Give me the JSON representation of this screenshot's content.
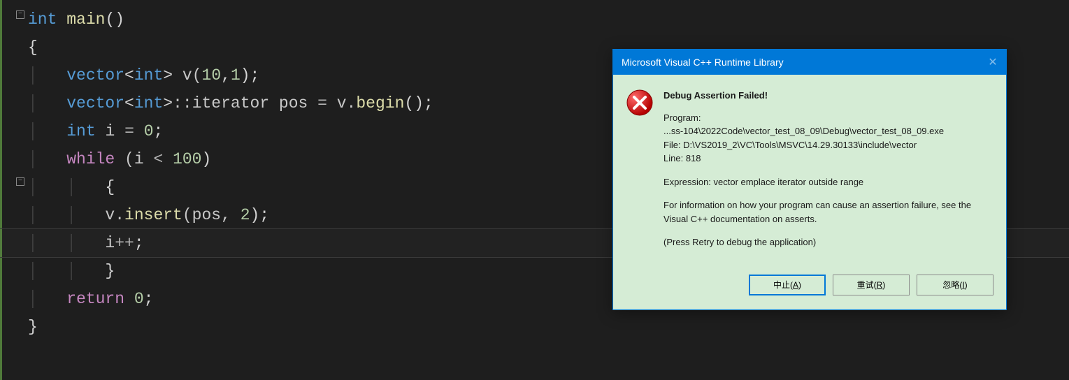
{
  "code": {
    "l1_int": "int",
    "l1_main": "main",
    "l1_parens": "()",
    "l2": "{",
    "l3_vector": "vector",
    "l3_int": "int",
    "l3_v": " v(",
    "l3_10": "10",
    "l3_comma": ",",
    "l3_1": "1",
    "l3_close": ");",
    "l4_vector": "vector",
    "l4_int": "int",
    "l4_iter": "::iterator pos ",
    "l4_eq": "=",
    "l4_vbegin": " v.",
    "l4_begin": "begin",
    "l4_end": "();",
    "l5_int": "int",
    "l5_rest": " i ",
    "l5_eq": "=",
    "l5_sp": " ",
    "l5_0": "0",
    "l5_semi": ";",
    "l6_while": "while",
    "l6_open": " (i ",
    "l6_lt": "<",
    "l6_sp": " ",
    "l6_100": "100",
    "l6_close": ")",
    "l7": "{",
    "l8_vinsert": "v.",
    "l8_insert": "insert",
    "l8_args": "(pos, ",
    "l8_2": "2",
    "l8_close": ");",
    "l9": "i",
    "l9_pp": "++",
    "l9_semi": ";",
    "l10": "}",
    "l11_return": "return",
    "l11_sp": " ",
    "l11_0": "0",
    "l11_semi": ";",
    "l12": "}"
  },
  "dialog": {
    "title": "Microsoft Visual C++ Runtime Library",
    "heading": "Debug Assertion Failed!",
    "program_label": "Program:",
    "program_path": "...ss-104\\2022Code\\vector_test_08_09\\Debug\\vector_test_08_09.exe",
    "file_label": "File: ",
    "file_path": "D:\\VS2019_2\\VC\\Tools\\MSVC\\14.29.30133\\include\\vector",
    "line_label": "Line: ",
    "line_num": "818",
    "expr_label": "Expression: ",
    "expr_text": "vector emplace iterator outside range",
    "info_text": "For information on how your program can cause an assertion failure, see the Visual C++ documentation on asserts.",
    "retry_text": "(Press Retry to debug the application)",
    "btn_abort_pre": "中止(",
    "btn_abort_u": "A",
    "btn_abort_post": ")",
    "btn_retry_pre": "重试(",
    "btn_retry_u": "R",
    "btn_retry_post": ")",
    "btn_ignore_pre": "忽略(",
    "btn_ignore_u": "I",
    "btn_ignore_post": ")"
  }
}
